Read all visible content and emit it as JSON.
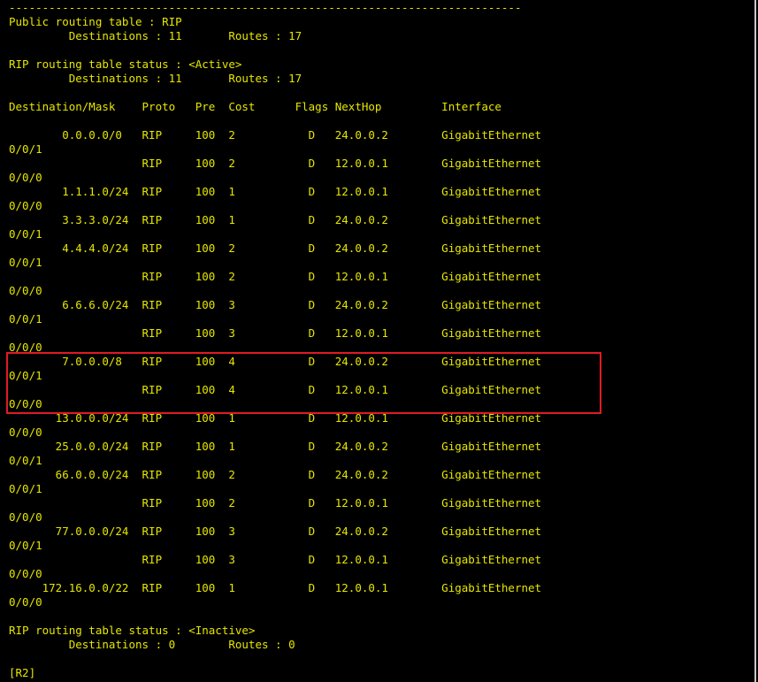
{
  "colors": {
    "background": "#000000",
    "text": "#e6e600",
    "highlight_border": "#e01b24",
    "scrollbar_edge": "#c8c8c8"
  },
  "terminal": {
    "separator": "-----------------------------------------------------------------------------",
    "public_table_title": "Public routing table : RIP",
    "public_table_counts": "         Destinations : 11       Routes : 17",
    "active_status": "RIP routing table status : <Active>",
    "active_counts": "         Destinations : 11       Routes : 17",
    "column_header": "Destination/Mask    Proto   Pre  Cost      Flags NextHop         Interface",
    "routes": [
      {
        "text": "        0.0.0.0/0   RIP     100  2           D   24.0.0.2        GigabitEthernet",
        "cont": "0/0/1"
      },
      {
        "text": "                    RIP     100  2           D   12.0.0.1        GigabitEthernet",
        "cont": "0/0/0"
      },
      {
        "text": "        1.1.1.0/24  RIP     100  1           D   12.0.0.1        GigabitEthernet",
        "cont": "0/0/0"
      },
      {
        "text": "        3.3.3.0/24  RIP     100  1           D   24.0.0.2        GigabitEthernet",
        "cont": "0/0/1"
      },
      {
        "text": "        4.4.4.0/24  RIP     100  2           D   24.0.0.2        GigabitEthernet",
        "cont": "0/0/1"
      },
      {
        "text": "                    RIP     100  2           D   12.0.0.1        GigabitEthernet",
        "cont": "0/0/0"
      },
      {
        "text": "        6.6.6.0/24  RIP     100  3           D   24.0.0.2        GigabitEthernet",
        "cont": "0/0/1"
      },
      {
        "text": "                    RIP     100  3           D   12.0.0.1        GigabitEthernet",
        "cont": "0/0/0"
      },
      {
        "text": "        7.0.0.0/8   RIP     100  4           D   24.0.0.2        GigabitEthernet",
        "cont": "0/0/1"
      },
      {
        "text": "                    RIP     100  4           D   12.0.0.1        GigabitEthernet",
        "cont": "0/0/0"
      },
      {
        "text": "       13.0.0.0/24  RIP     100  1           D   12.0.0.1        GigabitEthernet",
        "cont": "0/0/0"
      },
      {
        "text": "       25.0.0.0/24  RIP     100  1           D   24.0.0.2        GigabitEthernet",
        "cont": "0/0/1"
      },
      {
        "text": "       66.0.0.0/24  RIP     100  2           D   24.0.0.2        GigabitEthernet",
        "cont": "0/0/1"
      },
      {
        "text": "                    RIP     100  2           D   12.0.0.1        GigabitEthernet",
        "cont": "0/0/0"
      },
      {
        "text": "       77.0.0.0/24  RIP     100  3           D   24.0.0.2        GigabitEthernet",
        "cont": "0/0/1"
      },
      {
        "text": "                    RIP     100  3           D   12.0.0.1        GigabitEthernet",
        "cont": "0/0/0"
      },
      {
        "text": "     172.16.0.0/22  RIP     100  1           D   12.0.0.1        GigabitEthernet",
        "cont": "0/0/0"
      }
    ],
    "inactive_status": "RIP routing table status : <Inactive>",
    "inactive_counts": "         Destinations : 0        Routes : 0",
    "prompt": "[R2]"
  }
}
